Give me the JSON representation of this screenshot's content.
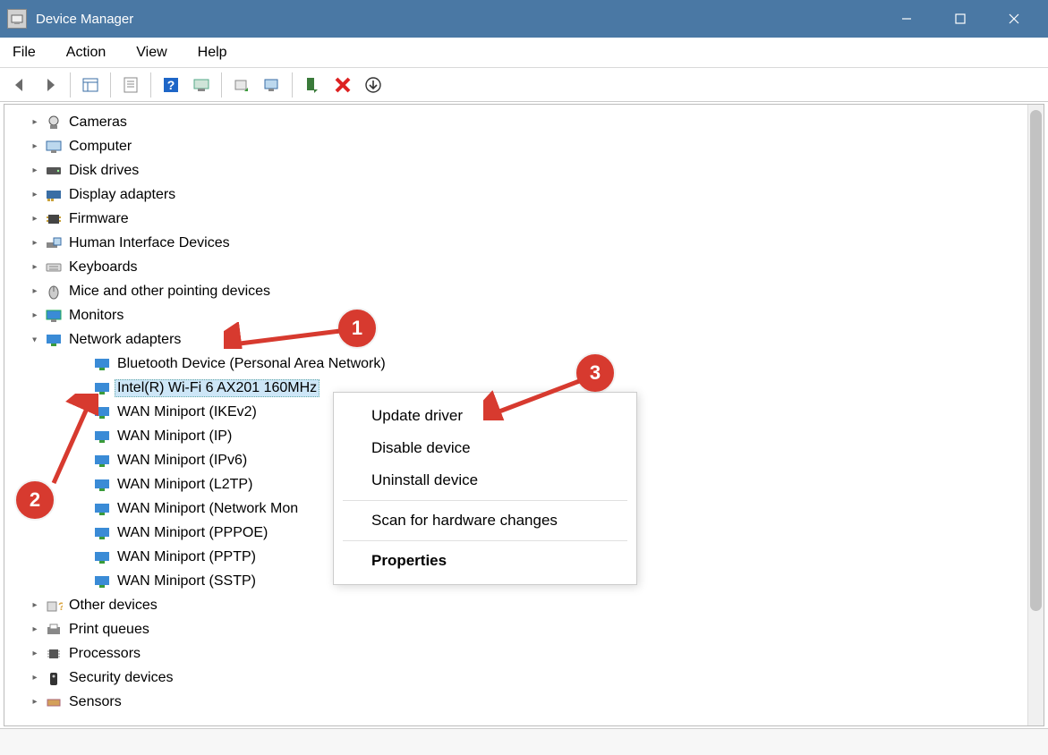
{
  "window": {
    "title": "Device Manager"
  },
  "menu": {
    "file": "File",
    "action": "Action",
    "view": "View",
    "help": "Help"
  },
  "tree": {
    "cameras": "Cameras",
    "computer": "Computer",
    "disk_drives": "Disk drives",
    "display_adapters": "Display adapters",
    "firmware": "Firmware",
    "hid": "Human Interface Devices",
    "keyboards": "Keyboards",
    "mice": "Mice and other pointing devices",
    "monitors": "Monitors",
    "network_adapters": "Network adapters",
    "na_children": {
      "bt": "Bluetooth Device (Personal Area Network)",
      "wifi": "Intel(R) Wi-Fi 6 AX201 160MHz",
      "wan_ikev2": "WAN Miniport (IKEv2)",
      "wan_ip": "WAN Miniport (IP)",
      "wan_ipv6": "WAN Miniport (IPv6)",
      "wan_l2tp": "WAN Miniport (L2TP)",
      "wan_netmon": "WAN Miniport (Network Mon",
      "wan_pppoe": "WAN Miniport (PPPOE)",
      "wan_pptp": "WAN Miniport (PPTP)",
      "wan_sstp": "WAN Miniport (SSTP)"
    },
    "other_devices": "Other devices",
    "print_queues": "Print queues",
    "processors": "Processors",
    "security_devices": "Security devices",
    "sensors": "Sensors"
  },
  "context_menu": {
    "update_driver": "Update driver",
    "disable_device": "Disable device",
    "uninstall_device": "Uninstall device",
    "scan": "Scan for hardware changes",
    "properties": "Properties"
  },
  "annotations": {
    "b1": "1",
    "b2": "2",
    "b3": "3"
  }
}
